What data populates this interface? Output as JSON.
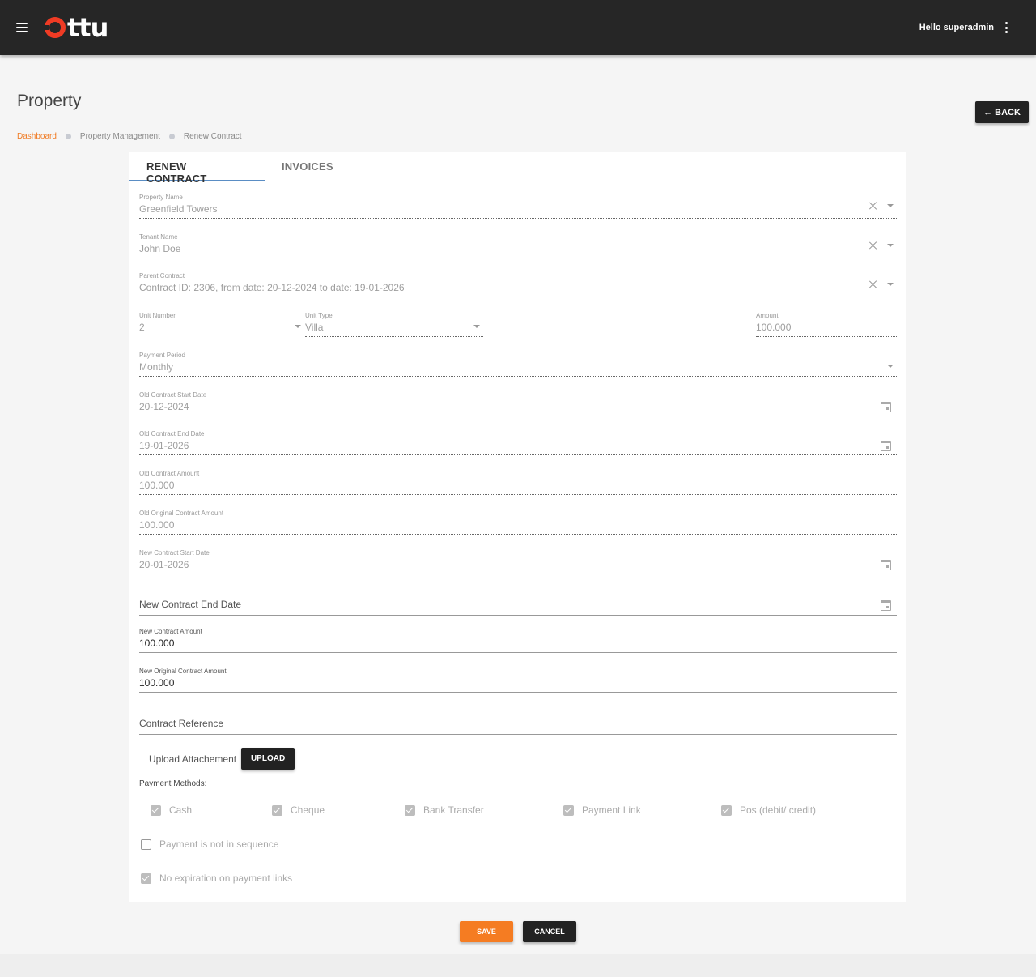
{
  "header": {
    "logo_text": "ttu",
    "greeting": "Hello superadmin",
    "brand_color": "#ef3b24"
  },
  "page": {
    "title": "Property",
    "back_label": "← BACK"
  },
  "breadcrumb": {
    "items": [
      "Dashboard",
      "Property Management",
      "Renew Contract"
    ]
  },
  "tabs": [
    "RENEW CONTRACT",
    "INVOICES"
  ],
  "form": {
    "property_name": {
      "label": "Property Name",
      "value": "Greenfield Towers"
    },
    "tenant_name": {
      "label": "Tenant Name",
      "value": "John Doe"
    },
    "parent_contract": {
      "label": "Parent Contract",
      "value": "Contract ID: 2306, from date: 20-12-2024 to date: 19-01-2026"
    },
    "unit_number": {
      "label": "Unit Number",
      "value": "2"
    },
    "unit_type": {
      "label": "Unit Type",
      "value": "Villa"
    },
    "amount": {
      "label": "Amount",
      "value": "100.000"
    },
    "payment_period": {
      "label": "Payment Period",
      "value": "Monthly"
    },
    "old_start_date": {
      "label": "Old Contract Start Date",
      "value": "20-12-2024"
    },
    "old_end_date": {
      "label": "Old Contract End Date",
      "value": "19-01-2026"
    },
    "old_amount": {
      "label": "Old Contract Amount",
      "value": "100.000"
    },
    "old_original_amount": {
      "label": "Old Original Contract Amount",
      "value": "100.000"
    },
    "new_start_date": {
      "label": "New Contract Start Date",
      "value": "20-01-2026"
    },
    "new_end_date": {
      "placeholder": "New Contract End Date"
    },
    "new_amount": {
      "label": "New Contract Amount",
      "value": "100.000"
    },
    "new_original_amount": {
      "label": "New Original Contract Amount",
      "value": "100.000"
    },
    "contract_reference": {
      "placeholder": "Contract Reference"
    },
    "upload_label": "Upload Attachement",
    "upload_button": "UPLOAD"
  },
  "payment_methods": {
    "title": "Payment Methods:",
    "options": [
      {
        "label": "Cash",
        "checked": true
      },
      {
        "label": "Cheque",
        "checked": true
      },
      {
        "label": "Bank Transfer",
        "checked": true
      },
      {
        "label": "Payment Link",
        "checked": true
      },
      {
        "label": "Pos (debit/ credit)",
        "checked": true
      }
    ]
  },
  "options": {
    "not_in_sequence": {
      "label": "Payment is not in sequence",
      "checked": false
    },
    "no_expiration": {
      "label": "No expiration on payment links",
      "checked": true
    }
  },
  "actions": {
    "save": "SAVE",
    "cancel": "CANCEL",
    "save_color": "#f57c22"
  }
}
